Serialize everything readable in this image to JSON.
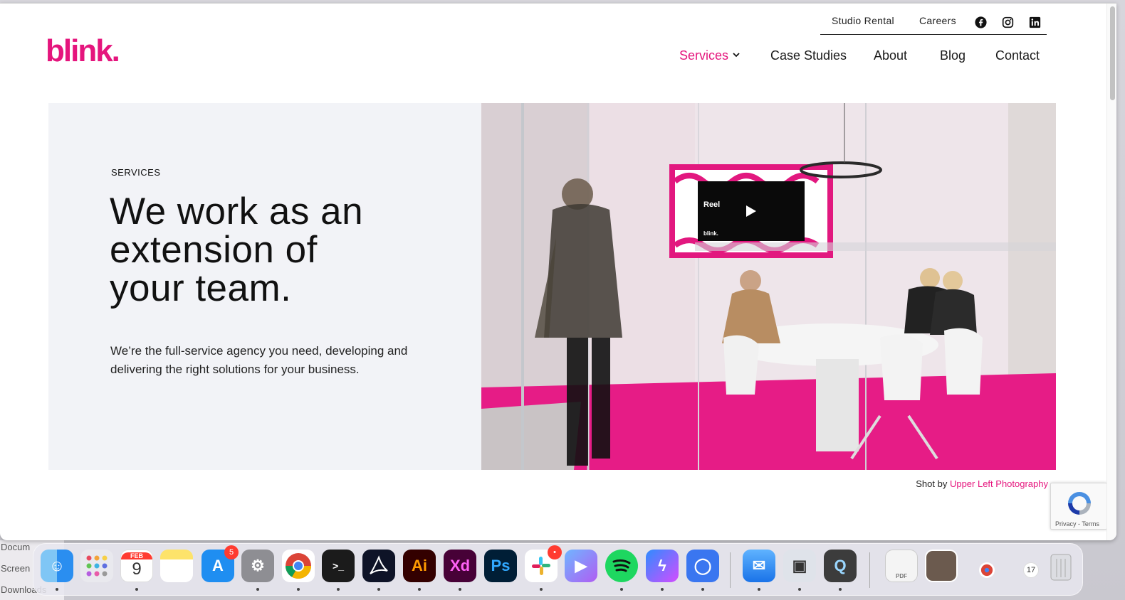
{
  "brand": {
    "logo_text": "blink.",
    "accent": "#e5157d"
  },
  "top_nav": {
    "studio_rental": "Studio Rental",
    "careers": "Careers"
  },
  "main_nav": [
    {
      "label": "Services",
      "active": true
    },
    {
      "label": "Case Studies"
    },
    {
      "label": "About"
    },
    {
      "label": "Blog"
    },
    {
      "label": "Contact"
    }
  ],
  "hero": {
    "kicker": "SERVICES",
    "headline_line1": "We work as an",
    "headline_line2": "extension of",
    "headline_line3": "your team.",
    "lede": "We’re the full-service agency you need, developing and delivering the right solutions for your business."
  },
  "photo": {
    "tv_label": "Reel",
    "tv_logo": "blink."
  },
  "credit": {
    "prefix": "Shot by",
    "link": "Upper Left Photography"
  },
  "recaptcha": {
    "text": "Privacy - Terms"
  },
  "finder_sidebar": [
    "Docum",
    "Screen",
    "Downloads"
  ],
  "dock": {
    "calendar_month": "FEB",
    "calendar_day": "9",
    "appstore_badge": "5",
    "slack_badge": "•",
    "illustrator": "Ai",
    "xd": "Xd",
    "photoshop": "Ps",
    "pdf_label": "PDF",
    "mini_calendar": "17"
  }
}
